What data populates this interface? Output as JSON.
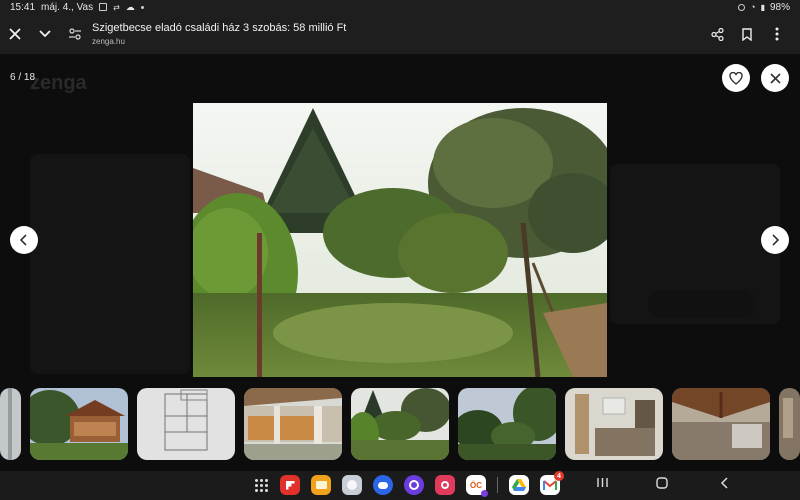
{
  "status_bar": {
    "time": "15:41",
    "date": "máj. 4., Vas",
    "battery": "98%"
  },
  "toolbar": {
    "close_icon": "close-icon",
    "collapse_icon": "chevron-down-icon",
    "site_settings_icon": "tune-icon",
    "title": "Szigetbecse eladó családi ház 3 szobás: 58 millió Ft",
    "url": "zenga.hu",
    "share_icon": "share-icon",
    "bookmark_icon": "bookmark-icon",
    "menu_icon": "more-vert-icon"
  },
  "gallery": {
    "counter": "6 / 18",
    "favorite_icon": "heart-icon",
    "close_icon": "close-icon",
    "prev_icon": "chevron-left-icon",
    "next_icon": "chevron-right-icon",
    "selected_index": 3
  },
  "thumbnails": [
    {
      "subject": "partial"
    },
    {
      "subject": "gazebo"
    },
    {
      "subject": "floor-plan"
    },
    {
      "subject": "terrace"
    },
    {
      "subject": "garden"
    },
    {
      "subject": "trees"
    },
    {
      "subject": "room"
    },
    {
      "subject": "attic"
    },
    {
      "subject": "partial"
    }
  ],
  "navbar": {
    "apps": [
      "apps-grid-icon",
      "flipboard-icon",
      "folder-icon",
      "gallery-icon",
      "messages-icon",
      "internet-icon",
      "camera-icon",
      "oc-app-icon",
      "drive-icon",
      "gmail-icon"
    ],
    "gmail_badge": "4",
    "oc_label": "ÖC",
    "recent_icon": "recent-apps-icon",
    "home_icon": "home-icon",
    "back_icon": "back-icon"
  },
  "colors": {
    "chrome_bg": "#1e1e1e",
    "overlay_bg": "#000000",
    "button_bg": "#ffffff"
  }
}
